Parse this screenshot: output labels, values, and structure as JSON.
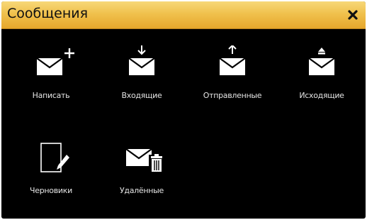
{
  "window": {
    "title": "Сообщения",
    "close_icon": "close-x-icon",
    "colors": {
      "title_bar": "#f0c14d",
      "background": "#000000",
      "icon": "#ffffff"
    }
  },
  "items": [
    {
      "label": "Написать",
      "icon": "envelope-plus-icon"
    },
    {
      "label": "Входящие",
      "icon": "envelope-arrow-down-icon"
    },
    {
      "label": "Отправленные",
      "icon": "envelope-arrow-up-icon"
    },
    {
      "label": "Исходящие",
      "icon": "envelope-outbox-icon"
    },
    {
      "label": "Черновики",
      "icon": "draft-pencil-icon"
    },
    {
      "label": "Удалённые",
      "icon": "envelope-trash-icon"
    }
  ]
}
